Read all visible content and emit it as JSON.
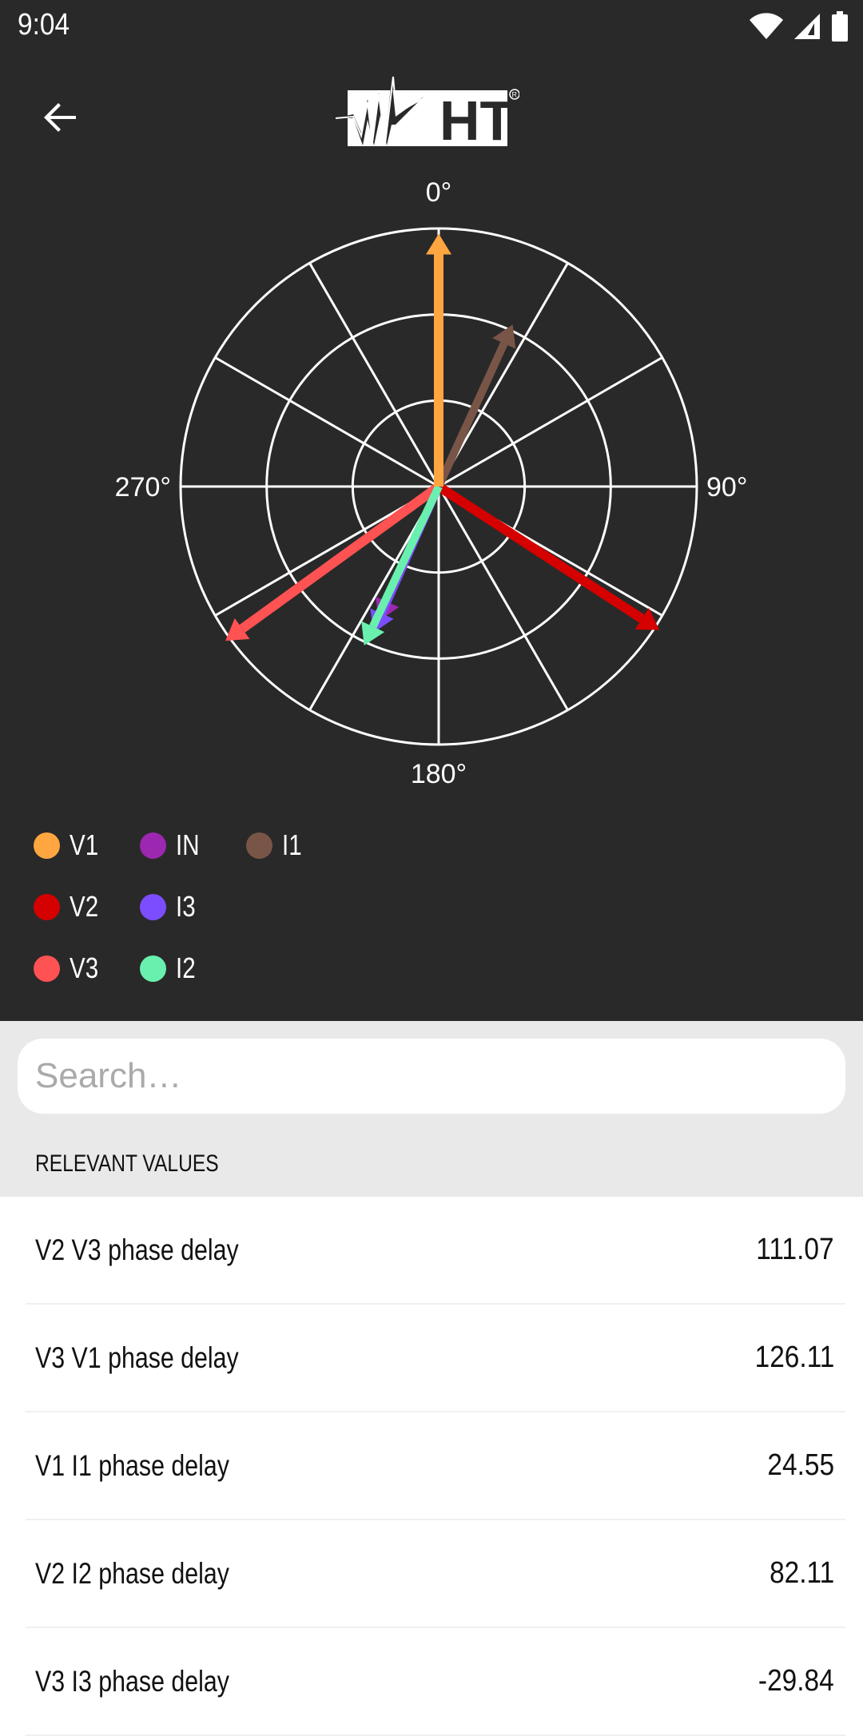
{
  "status_bar": {
    "time": "9:04",
    "icons": [
      "wifi-icon",
      "signal-icon",
      "battery-icon"
    ]
  },
  "app_bar": {
    "back_icon": "arrow-back-icon",
    "logo_text": "HT",
    "logo_mark": "®"
  },
  "chart_data": {
    "type": "polar-phasor",
    "title": "",
    "angle_direction": "clockwise",
    "zero_at": "top",
    "angle_labels": [
      "0°",
      "90°",
      "180°",
      "270°"
    ],
    "rings": 3,
    "spokes_every_deg": 30,
    "r_max": 1.0,
    "series": [
      {
        "name": "V1",
        "color": "#ffa640",
        "angle_deg": 0,
        "magnitude": 0.98,
        "width": "thick"
      },
      {
        "name": "IN",
        "color": "#9c27b0",
        "angle_deg": 204,
        "magnitude": 0.57,
        "width": "thin"
      },
      {
        "name": "I1",
        "color": "#795548",
        "angle_deg": 24.55,
        "magnitude": 0.69,
        "width": "mid"
      },
      {
        "name": "V2",
        "color": "#d50000",
        "angle_deg": 123.04,
        "magnitude": 1.02,
        "width": "thick"
      },
      {
        "name": "I3",
        "color": "#7c4dff",
        "angle_deg": 204.05,
        "magnitude": 0.62,
        "width": "mid"
      },
      {
        "name": "V3",
        "color": "#ff5252",
        "angle_deg": 234.11,
        "magnitude": 1.02,
        "width": "thick"
      },
      {
        "name": "I2",
        "color": "#69f0ae",
        "angle_deg": 205.15,
        "magnitude": 0.68,
        "width": "mid"
      }
    ]
  },
  "legend": {
    "rows": [
      [
        {
          "label": "V1",
          "color": "#ffa640"
        },
        {
          "label": "IN",
          "color": "#9c27b0"
        },
        {
          "label": "I1",
          "color": "#795548"
        }
      ],
      [
        {
          "label": "V2",
          "color": "#d50000"
        },
        {
          "label": "I3",
          "color": "#7c4dff"
        }
      ],
      [
        {
          "label": "V3",
          "color": "#ff5252"
        },
        {
          "label": "I2",
          "color": "#69f0ae"
        }
      ]
    ]
  },
  "search": {
    "placeholder": "Search…",
    "value": ""
  },
  "section_title": "RELEVANT VALUES",
  "values": [
    {
      "name": "V2 V3 phase delay",
      "value": "111.07"
    },
    {
      "name": "V3 V1 phase delay",
      "value": "126.11"
    },
    {
      "name": "V1 I1 phase delay",
      "value": "24.55"
    },
    {
      "name": "V2 I2 phase delay",
      "value": "82.11"
    },
    {
      "name": "V3 I3 phase delay",
      "value": "-29.84"
    }
  ]
}
